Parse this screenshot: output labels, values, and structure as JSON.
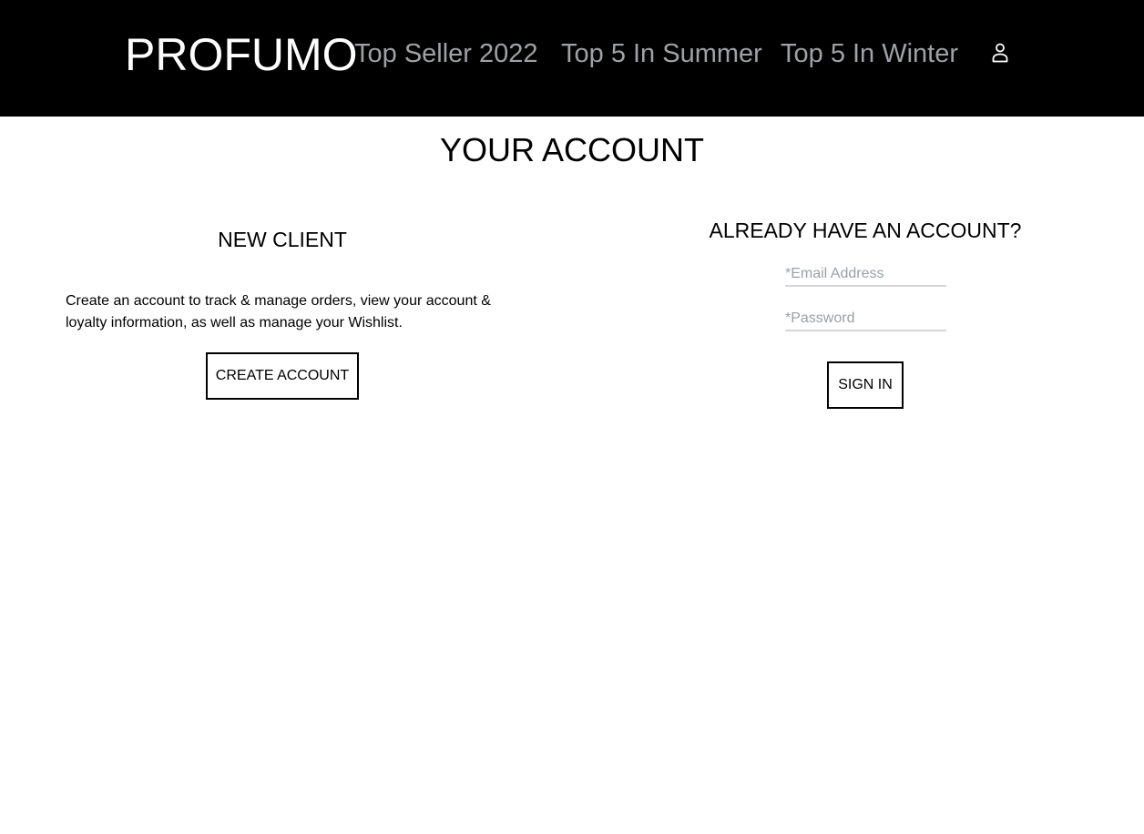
{
  "header": {
    "brand": "PROFUMO",
    "nav": [
      {
        "label": "Top Seller 2022"
      },
      {
        "label": "Top 5 In Summer"
      },
      {
        "label": "Top 5 In Winter"
      }
    ],
    "account_icon": "user-icon",
    "colors": {
      "background": "#000000",
      "brand": "#ffffff",
      "nav": "#9ea1a6"
    }
  },
  "page": {
    "title": "YOUR ACCOUNT"
  },
  "new_client": {
    "heading": "NEW CLIENT",
    "description": "Create an account to track & manage orders, view your account & loyalty information, as well as manage your Wishlist.",
    "button_label": "CREATE ACCOUNT"
  },
  "sign_in": {
    "heading": "ALREADY HAVE AN ACCOUNT?",
    "email": {
      "value": "",
      "placeholder": "*Email Address"
    },
    "password": {
      "value": "",
      "placeholder": "*Password"
    },
    "button_label": "SIGN IN"
  }
}
